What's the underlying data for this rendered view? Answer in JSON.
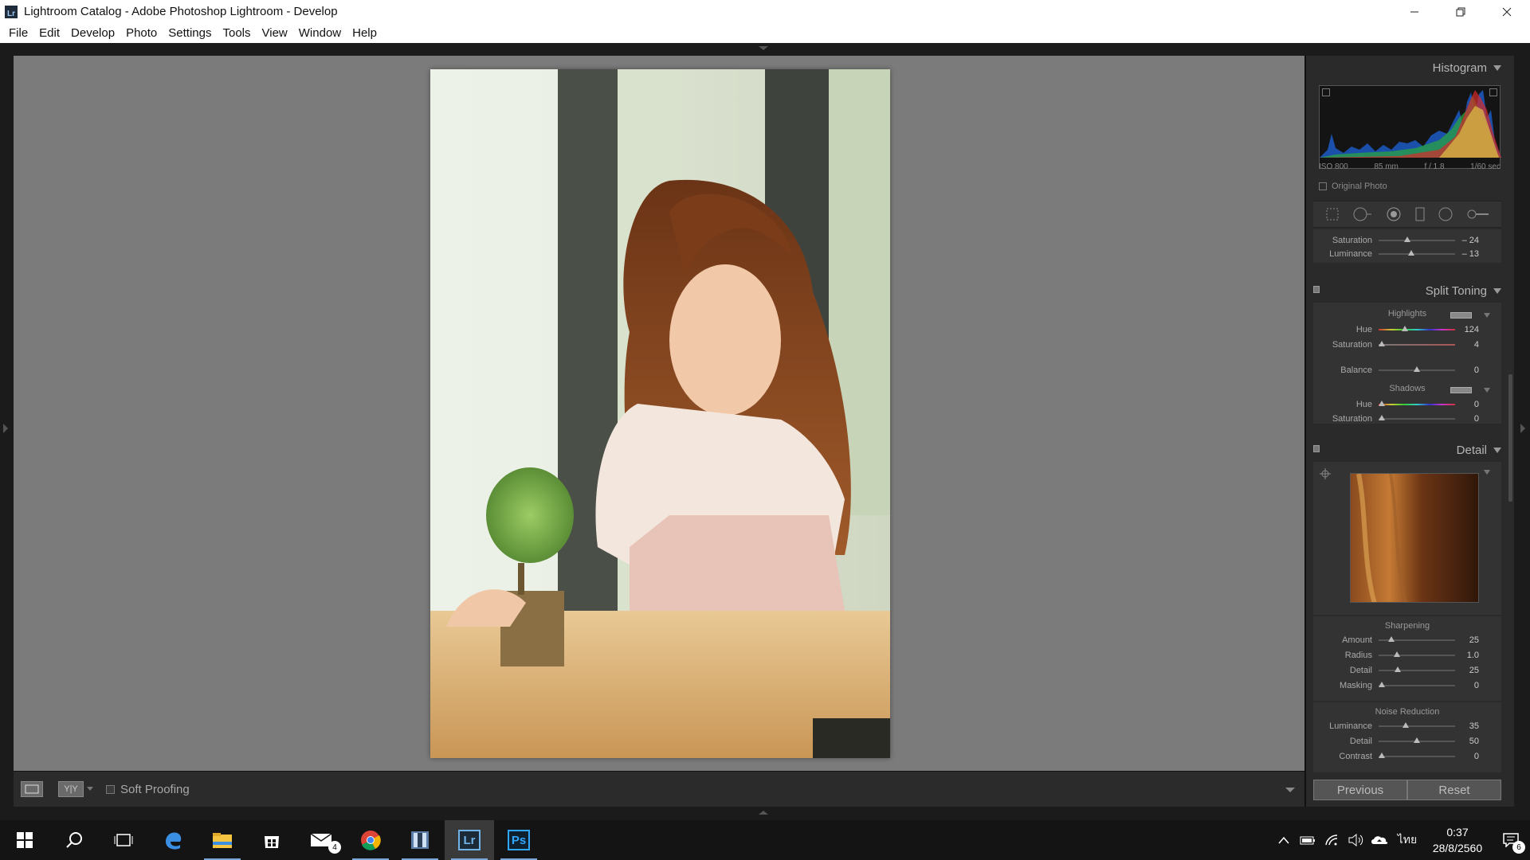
{
  "window": {
    "title": "Lightroom Catalog - Adobe Photoshop Lightroom - Develop",
    "app_icon_label": "Lr",
    "controls": {
      "minimize_icon": "minimize-icon",
      "restore_icon": "restore-icon",
      "close_icon": "close-icon"
    }
  },
  "menu": [
    "File",
    "Edit",
    "Develop",
    "Photo",
    "Settings",
    "Tools",
    "View",
    "Window",
    "Help"
  ],
  "toolbar": {
    "soft_proofing_label": "Soft Proofing",
    "compare_label": "Y|Y"
  },
  "histogram": {
    "title": "Histogram",
    "iso": "ISO 800",
    "focal": "85 mm",
    "aperture": "f / 1.8",
    "shutter": "1/60 sec",
    "original_photo_label": "Original Photo"
  },
  "hsl_partial": [
    {
      "label": "Saturation",
      "value": "– 24",
      "pos": 0.38
    },
    {
      "label": "Luminance",
      "value": "– 13",
      "pos": 0.43
    }
  ],
  "split_toning": {
    "title": "Split Toning",
    "highlights_label": "Highlights",
    "highlights": [
      {
        "label": "Hue",
        "value": "124",
        "pos": 0.34
      },
      {
        "label": "Saturation",
        "value": "4",
        "pos": 0.04
      }
    ],
    "balance": {
      "label": "Balance",
      "value": "0",
      "pos": 0.5
    },
    "shadows_label": "Shadows",
    "shadows": [
      {
        "label": "Hue",
        "value": "0",
        "pos": 0.0
      },
      {
        "label": "Saturation",
        "value": "0",
        "pos": 0.0
      }
    ]
  },
  "detail": {
    "title": "Detail",
    "sharpening_label": "Sharpening",
    "sharpening": [
      {
        "label": "Amount",
        "value": "25",
        "pos": 0.17
      },
      {
        "label": "Radius",
        "value": "1.0",
        "pos": 0.24
      },
      {
        "label": "Detail",
        "value": "25",
        "pos": 0.25
      },
      {
        "label": "Masking",
        "value": "0",
        "pos": 0.0
      }
    ],
    "noise_label": "Noise Reduction",
    "noise": [
      {
        "label": "Luminance",
        "value": "35",
        "pos": 0.35
      },
      {
        "label": "Detail",
        "value": "50",
        "pos": 0.5
      },
      {
        "label": "Contrast",
        "value": "0",
        "pos": 0.0
      }
    ]
  },
  "buttons": {
    "previous": "Previous",
    "reset": "Reset"
  },
  "taskbar": {
    "apps": [
      "windows-start-icon",
      "search-icon",
      "task-view-icon",
      "edge-icon",
      "file-explorer-icon",
      "store-icon",
      "mail-icon",
      "chrome-icon",
      "photo-viewer-icon",
      "lightroom-icon",
      "photoshop-icon"
    ],
    "mail_badge": "4",
    "lr_label": "Lr",
    "ps_label": "Ps",
    "language": "ไทย",
    "time": "0:37",
    "date": "28/8/2560",
    "notification_badge": "6"
  }
}
